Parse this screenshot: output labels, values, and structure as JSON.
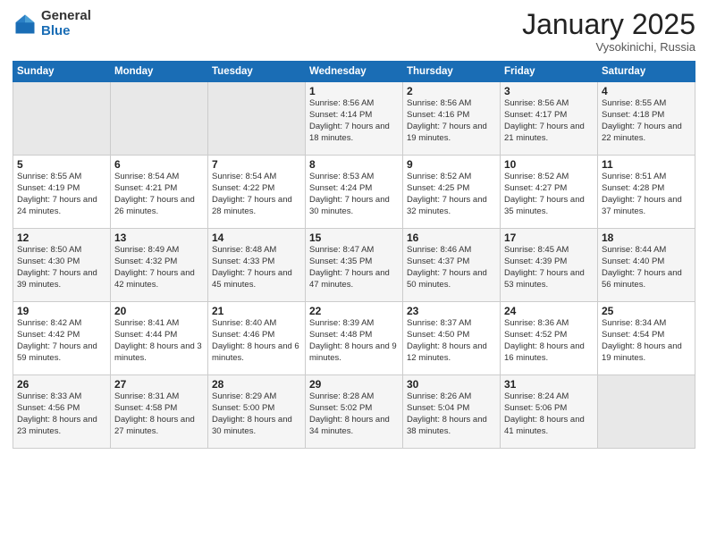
{
  "logo": {
    "general": "General",
    "blue": "Blue"
  },
  "header": {
    "month": "January 2025",
    "location": "Vysokinichi, Russia"
  },
  "weekdays": [
    "Sunday",
    "Monday",
    "Tuesday",
    "Wednesday",
    "Thursday",
    "Friday",
    "Saturday"
  ],
  "weeks": [
    [
      {
        "day": "",
        "info": ""
      },
      {
        "day": "",
        "info": ""
      },
      {
        "day": "",
        "info": ""
      },
      {
        "day": "1",
        "info": "Sunrise: 8:56 AM\nSunset: 4:14 PM\nDaylight: 7 hours\nand 18 minutes."
      },
      {
        "day": "2",
        "info": "Sunrise: 8:56 AM\nSunset: 4:16 PM\nDaylight: 7 hours\nand 19 minutes."
      },
      {
        "day": "3",
        "info": "Sunrise: 8:56 AM\nSunset: 4:17 PM\nDaylight: 7 hours\nand 21 minutes."
      },
      {
        "day": "4",
        "info": "Sunrise: 8:55 AM\nSunset: 4:18 PM\nDaylight: 7 hours\nand 22 minutes."
      }
    ],
    [
      {
        "day": "5",
        "info": "Sunrise: 8:55 AM\nSunset: 4:19 PM\nDaylight: 7 hours\nand 24 minutes."
      },
      {
        "day": "6",
        "info": "Sunrise: 8:54 AM\nSunset: 4:21 PM\nDaylight: 7 hours\nand 26 minutes."
      },
      {
        "day": "7",
        "info": "Sunrise: 8:54 AM\nSunset: 4:22 PM\nDaylight: 7 hours\nand 28 minutes."
      },
      {
        "day": "8",
        "info": "Sunrise: 8:53 AM\nSunset: 4:24 PM\nDaylight: 7 hours\nand 30 minutes."
      },
      {
        "day": "9",
        "info": "Sunrise: 8:52 AM\nSunset: 4:25 PM\nDaylight: 7 hours\nand 32 minutes."
      },
      {
        "day": "10",
        "info": "Sunrise: 8:52 AM\nSunset: 4:27 PM\nDaylight: 7 hours\nand 35 minutes."
      },
      {
        "day": "11",
        "info": "Sunrise: 8:51 AM\nSunset: 4:28 PM\nDaylight: 7 hours\nand 37 minutes."
      }
    ],
    [
      {
        "day": "12",
        "info": "Sunrise: 8:50 AM\nSunset: 4:30 PM\nDaylight: 7 hours\nand 39 minutes."
      },
      {
        "day": "13",
        "info": "Sunrise: 8:49 AM\nSunset: 4:32 PM\nDaylight: 7 hours\nand 42 minutes."
      },
      {
        "day": "14",
        "info": "Sunrise: 8:48 AM\nSunset: 4:33 PM\nDaylight: 7 hours\nand 45 minutes."
      },
      {
        "day": "15",
        "info": "Sunrise: 8:47 AM\nSunset: 4:35 PM\nDaylight: 7 hours\nand 47 minutes."
      },
      {
        "day": "16",
        "info": "Sunrise: 8:46 AM\nSunset: 4:37 PM\nDaylight: 7 hours\nand 50 minutes."
      },
      {
        "day": "17",
        "info": "Sunrise: 8:45 AM\nSunset: 4:39 PM\nDaylight: 7 hours\nand 53 minutes."
      },
      {
        "day": "18",
        "info": "Sunrise: 8:44 AM\nSunset: 4:40 PM\nDaylight: 7 hours\nand 56 minutes."
      }
    ],
    [
      {
        "day": "19",
        "info": "Sunrise: 8:42 AM\nSunset: 4:42 PM\nDaylight: 7 hours\nand 59 minutes."
      },
      {
        "day": "20",
        "info": "Sunrise: 8:41 AM\nSunset: 4:44 PM\nDaylight: 8 hours\nand 3 minutes."
      },
      {
        "day": "21",
        "info": "Sunrise: 8:40 AM\nSunset: 4:46 PM\nDaylight: 8 hours\nand 6 minutes."
      },
      {
        "day": "22",
        "info": "Sunrise: 8:39 AM\nSunset: 4:48 PM\nDaylight: 8 hours\nand 9 minutes."
      },
      {
        "day": "23",
        "info": "Sunrise: 8:37 AM\nSunset: 4:50 PM\nDaylight: 8 hours\nand 12 minutes."
      },
      {
        "day": "24",
        "info": "Sunrise: 8:36 AM\nSunset: 4:52 PM\nDaylight: 8 hours\nand 16 minutes."
      },
      {
        "day": "25",
        "info": "Sunrise: 8:34 AM\nSunset: 4:54 PM\nDaylight: 8 hours\nand 19 minutes."
      }
    ],
    [
      {
        "day": "26",
        "info": "Sunrise: 8:33 AM\nSunset: 4:56 PM\nDaylight: 8 hours\nand 23 minutes."
      },
      {
        "day": "27",
        "info": "Sunrise: 8:31 AM\nSunset: 4:58 PM\nDaylight: 8 hours\nand 27 minutes."
      },
      {
        "day": "28",
        "info": "Sunrise: 8:29 AM\nSunset: 5:00 PM\nDaylight: 8 hours\nand 30 minutes."
      },
      {
        "day": "29",
        "info": "Sunrise: 8:28 AM\nSunset: 5:02 PM\nDaylight: 8 hours\nand 34 minutes."
      },
      {
        "day": "30",
        "info": "Sunrise: 8:26 AM\nSunset: 5:04 PM\nDaylight: 8 hours\nand 38 minutes."
      },
      {
        "day": "31",
        "info": "Sunrise: 8:24 AM\nSunset: 5:06 PM\nDaylight: 8 hours\nand 41 minutes."
      },
      {
        "day": "",
        "info": ""
      }
    ]
  ]
}
